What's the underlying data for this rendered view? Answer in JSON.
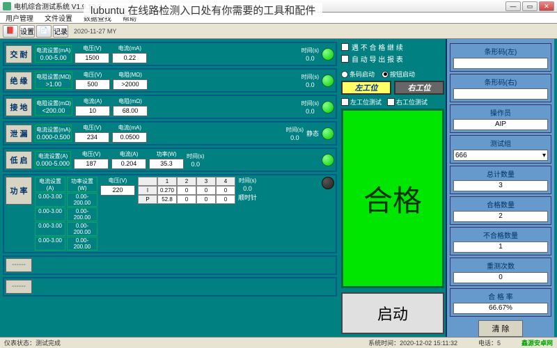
{
  "window": {
    "title": "电机综合测试系统 V1.9.10-2",
    "banner": "lubuntu 在线路检测入口处有你需要的工具和配件",
    "date_note": "2020-11-27 MY"
  },
  "menu": {
    "user": "用户管理",
    "file": "文件设置",
    "data": "数据查找",
    "help": "帮助"
  },
  "toolbar": {
    "btn1": "设置",
    "btn2": "记录"
  },
  "rows": {
    "jn": {
      "label": "交 耐",
      "setting_t": "电流设置(mA)",
      "setting_v": "0.00-5.00",
      "c1t": "电压(V)",
      "c1v": "1500",
      "c2t": "电流(mA)",
      "c2v": "0.22",
      "c3t": "时间(s)",
      "c3v": "0.0"
    },
    "jy": {
      "label": "绝 缘",
      "setting_t": "电阻设置(MΩ)",
      "setting_v": ">1.00",
      "c1t": "电压(V)",
      "c1v": "500",
      "c2t": "电阻(MΩ)",
      "c2v": ">2000",
      "c3t": "时间(s)",
      "c3v": "0.0"
    },
    "jd": {
      "label": "接 地",
      "setting_t": "电阻设置(mΩ)",
      "setting_v": "<200.00",
      "c1t": "电流(A)",
      "c1v": "10",
      "c2t": "电阻(mΩ)",
      "c2v": "68.00",
      "c3t": "时间(s)",
      "c3v": "0.0"
    },
    "xl": {
      "label": "泄 漏",
      "setting_t": "电流设置(mA)",
      "setting_v": "0.000-0.500",
      "c1t": "电压(V)",
      "c1v": "234",
      "c2t": "电流(mA)",
      "c2v": "0.0500",
      "c3t": "时间(s)",
      "c3v": "0.0",
      "extra": "静态"
    },
    "dq": {
      "label": "低 启",
      "setting_t": "电流设置(A)",
      "setting_v": "0.000-5.000",
      "c1t": "电压(V)",
      "c1v": "187",
      "c2t": "电流(A)",
      "c2v": "0.204",
      "c3t": "功率(W)",
      "c3v": "35.3",
      "c4t": "时间(s)",
      "c4v": "0.0"
    },
    "gl": {
      "label": "功 率",
      "s1t": "电流设置(A)",
      "s2t": "功率设置(W)",
      "s11": "0.00-3.00",
      "s12": "0.00-200.00",
      "s21": "0.00-3.00",
      "s22": "0.00-200.00",
      "s31": "0.00-3.00",
      "s32": "0.00-200.00",
      "s41": "0.00-3.00",
      "s42": "0.00-200.00",
      "c1t": "电压(V)",
      "c1v": "220",
      "h1": "1",
      "h2": "2",
      "h3": "3",
      "h4": "4",
      "rI": "I",
      "i1": "0.270",
      "i2": "0",
      "i3": "0",
      "i4": "0",
      "rP": "P",
      "p1": "52.8",
      "p2": "0",
      "p3": "0",
      "p4": "0",
      "tt": "时间(s)",
      "tv": "0.0",
      "dir": "顺时针"
    },
    "ph": "------"
  },
  "mid": {
    "opt1": "遇 不 合 格 继 续",
    "opt2": "自 动 导 出 报 表",
    "r1": "条码启动",
    "r2": "按钮启动",
    "st_l": "左工位",
    "st_r": "右工位",
    "t_l": "左工位测试",
    "t_r": "右工位测试",
    "result": "合格",
    "start": "启动"
  },
  "right": {
    "bc_l": "条形码(左)",
    "bc_r": "条形码(右)",
    "op_t": "操作员",
    "op_v": "AIP",
    "grp_t": "测试组",
    "grp_v": "666",
    "total_t": "总计数量",
    "total_v": "3",
    "pass_t": "合格数量",
    "pass_v": "2",
    "fail_t": "不合格数量",
    "fail_v": "1",
    "retest_t": "重测次数",
    "retest_v": "0",
    "rate_t": "合 格 率",
    "rate_v": "66.67%",
    "clear": "清 除"
  },
  "status": {
    "s1": "仪表状态：测试完成",
    "s2": "系统时间：2020-12-02 15:11:32",
    "s3": "电话：5",
    "wm": "鑫源安卓网"
  }
}
